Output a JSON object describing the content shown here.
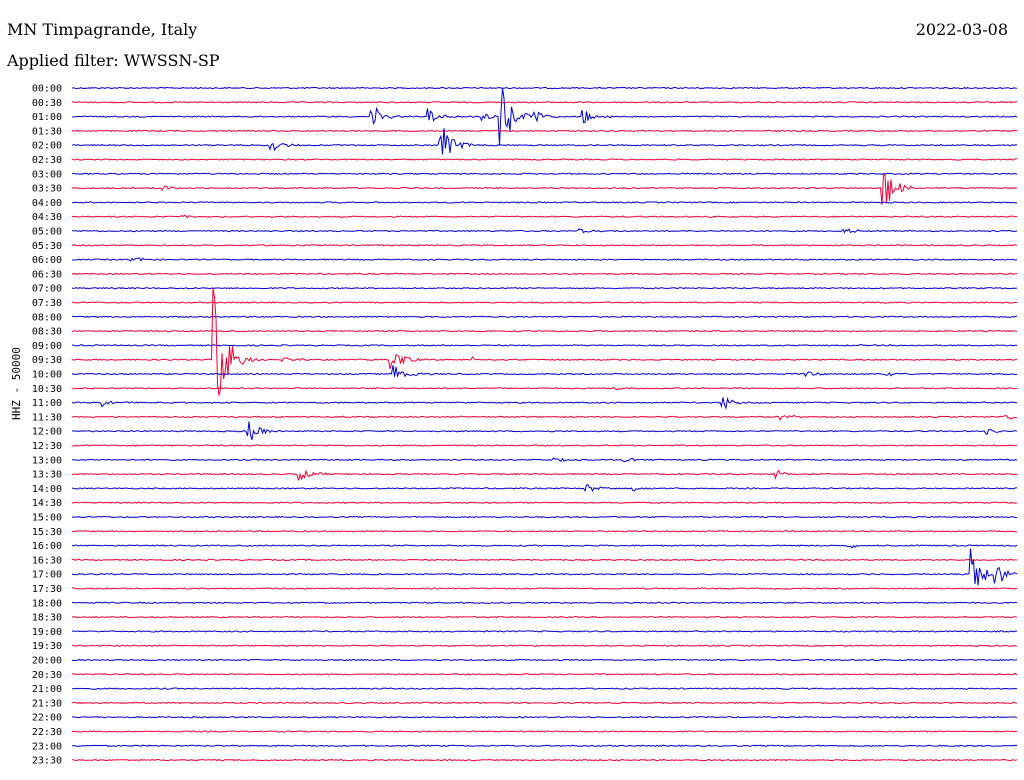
{
  "header": {
    "station": "MN Timpagrande, Italy",
    "date": "2022-03-08",
    "filter": "Applied filter: WWSSN-SP",
    "channel_label": "HHZ - 50000"
  },
  "colors": {
    "blue": "#0000cc",
    "red": "#ee0033"
  },
  "chart_data": {
    "type": "line",
    "title": "MN Timpagrande, Italy",
    "ylabel": "HHZ - 50000",
    "row_labels": [
      "00:00",
      "00:30",
      "01:00",
      "01:30",
      "02:00",
      "02:30",
      "03:00",
      "03:30",
      "04:00",
      "04:30",
      "05:00",
      "05:30",
      "06:00",
      "06:30",
      "07:00",
      "07:30",
      "08:00",
      "08:30",
      "09:00",
      "09:30",
      "10:00",
      "10:30",
      "11:00",
      "11:30",
      "12:00",
      "12:30",
      "13:00",
      "13:30",
      "14:00",
      "14:30",
      "15:00",
      "15:30",
      "16:00",
      "16:30",
      "17:00",
      "17:30",
      "18:00",
      "18:30",
      "19:00",
      "19:30",
      "20:00",
      "20:30",
      "21:00",
      "21:30",
      "22:00",
      "22:30",
      "23:00",
      "23:30"
    ],
    "row_minutes": 30,
    "events": [
      {
        "row": 2,
        "minute": 9.5,
        "amp": 0.9
      },
      {
        "row": 2,
        "minute": 11.3,
        "amp": 0.6
      },
      {
        "row": 2,
        "minute": 13,
        "amp": 0.3
      },
      {
        "row": 2,
        "minute": 13.6,
        "amp": 2.5
      },
      {
        "row": 2,
        "minute": 14.7,
        "amp": 0.4
      },
      {
        "row": 2,
        "minute": 16.2,
        "amp": 0.6
      },
      {
        "row": 4,
        "minute": 6.3,
        "amp": 0.5
      },
      {
        "row": 4,
        "minute": 11.7,
        "amp": 1.8
      },
      {
        "row": 5,
        "minute": 30,
        "amp": 0.3
      },
      {
        "row": 7,
        "minute": 2.9,
        "amp": 0.2
      },
      {
        "row": 7,
        "minute": 25.7,
        "amp": 1.8
      },
      {
        "row": 9,
        "minute": 3.5,
        "amp": 0.15
      },
      {
        "row": 10,
        "minute": 16.1,
        "amp": 0.2
      },
      {
        "row": 10,
        "minute": 24.5,
        "amp": 0.2
      },
      {
        "row": 12,
        "minute": 1.9,
        "amp": 0.2
      },
      {
        "row": 19,
        "minute": 4.5,
        "amp": 5.5
      },
      {
        "row": 19,
        "minute": 10.1,
        "amp": 1.0
      },
      {
        "row": 19,
        "minute": 6.7,
        "amp": 0.2
      },
      {
        "row": 19,
        "minute": 12.7,
        "amp": 0.2
      },
      {
        "row": 20,
        "minute": 10.2,
        "amp": 0.8
      },
      {
        "row": 20,
        "minute": 23.3,
        "amp": 0.2
      },
      {
        "row": 20,
        "minute": 25.7,
        "amp": 0.2
      },
      {
        "row": 21,
        "minute": 17.2,
        "amp": 0.15
      },
      {
        "row": 22,
        "minute": 20.6,
        "amp": 0.6
      },
      {
        "row": 22,
        "minute": 1,
        "amp": 0.3
      },
      {
        "row": 23,
        "minute": 22.5,
        "amp": 0.2
      },
      {
        "row": 23,
        "minute": 29.6,
        "amp": 0.2
      },
      {
        "row": 24,
        "minute": 5.6,
        "amp": 0.8
      },
      {
        "row": 24,
        "minute": 29.0,
        "amp": 0.2
      },
      {
        "row": 26,
        "minute": 15.3,
        "amp": 0.15
      },
      {
        "row": 26,
        "minute": 17.5,
        "amp": 0.15
      },
      {
        "row": 27,
        "minute": 7.2,
        "amp": 0.5
      },
      {
        "row": 27,
        "minute": 22.3,
        "amp": 0.35
      },
      {
        "row": 28,
        "minute": 16.3,
        "amp": 0.35
      },
      {
        "row": 28,
        "minute": 17.8,
        "amp": 0.2
      },
      {
        "row": 32,
        "minute": 24.6,
        "amp": 0.2
      },
      {
        "row": 34,
        "minute": 28.5,
        "amp": 2.0
      },
      {
        "row": 34,
        "minute": 29.3,
        "amp": 0.8
      }
    ]
  }
}
